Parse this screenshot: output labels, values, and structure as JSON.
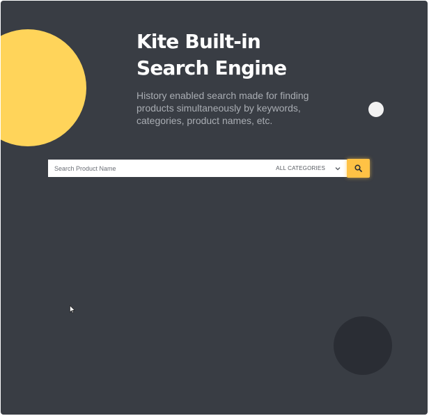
{
  "hero": {
    "title_line1": "Kite Built-in",
    "title_line2": "Search Engine",
    "subtitle": "History enabled search made for finding products simultaneously by keywords, categories, product names, etc."
  },
  "search": {
    "placeholder": "Search Product Name",
    "category_selected": "ALL CATEGORIES",
    "category_icon": "chevron-down-icon",
    "button_icon": "search-icon"
  },
  "colors": {
    "background": "#393d44",
    "accent_yellow": "#ffd45a",
    "button_yellow": "#ffc245",
    "title": "#ffffff",
    "subtitle": "#a9adb3"
  }
}
